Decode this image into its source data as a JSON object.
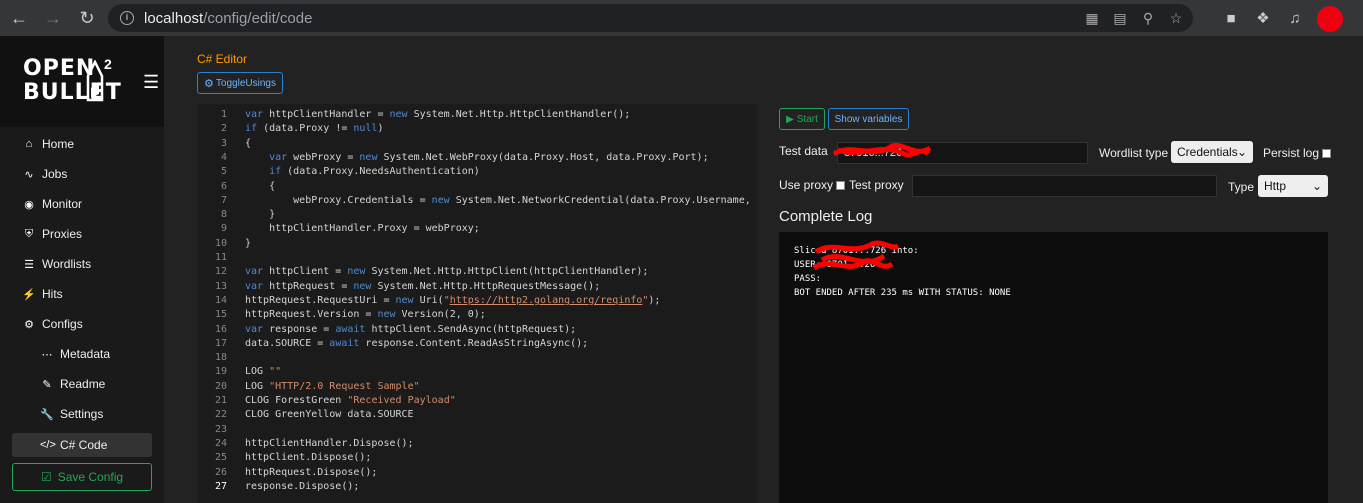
{
  "browser": {
    "url_host": "localhost",
    "url_path": "/config/edit/code"
  },
  "sidebar": {
    "logo_line1": "OPEN",
    "logo_line2": "BULLET",
    "logo_sup": "2",
    "items": [
      {
        "label": "Home",
        "icon": "home-icon"
      },
      {
        "label": "Jobs",
        "icon": "pulse-icon"
      },
      {
        "label": "Monitor",
        "icon": "eye-icon"
      },
      {
        "label": "Proxies",
        "icon": "shield-icon"
      },
      {
        "label": "Wordlists",
        "icon": "list-icon"
      },
      {
        "label": "Hits",
        "icon": "bolt-icon"
      },
      {
        "label": "Configs",
        "icon": "gear-icon"
      }
    ],
    "sub_items": [
      {
        "label": "Metadata",
        "icon": "dots-icon"
      },
      {
        "label": "Readme",
        "icon": "pencil-icon"
      },
      {
        "label": "Settings",
        "icon": "wrench-icon"
      },
      {
        "label": "C# Code",
        "icon": "code-icon"
      }
    ],
    "save_label": "Save Config"
  },
  "editor": {
    "title": "C# Editor",
    "toggle_label": "ToggleUsings",
    "lines": [
      "var httpClientHandler = new System.Net.Http.HttpClientHandler();",
      "if (data.Proxy != null)",
      "{",
      "    var webProxy = new System.Net.WebProxy(data.Proxy.Host, data.Proxy.Port);",
      "    if (data.Proxy.NeedsAuthentication)",
      "    {",
      "        webProxy.Credentials = new System.Net.NetworkCredential(data.Proxy.Username, data.Proxy.Password);",
      "    }",
      "    httpClientHandler.Proxy = webProxy;",
      "}",
      "",
      "var httpClient = new System.Net.Http.HttpClient(httpClientHandler);",
      "var httpRequest = new System.Net.Http.HttpRequestMessage();",
      "httpRequest.RequestUri = new Uri(\"https://http2.golang.org/reqinfo\");",
      "httpRequest.Version = new Version(2, 0);",
      "var response = await httpClient.SendAsync(httpRequest);",
      "data.SOURCE = await response.Content.ReadAsStringAsync();",
      "",
      "LOG \"\"",
      "LOG \"HTTP/2.0 Request Sample\"",
      "CLOG ForestGreen \"Received Payload\"",
      "CLOG GreenYellow data.SOURCE",
      "",
      "httpClientHandler.Dispose();",
      "httpClient.Dispose();",
      "httpRequest.Dispose();",
      "response.Dispose();"
    ]
  },
  "debugger": {
    "start_label": "Start",
    "vars_label": "Show variables",
    "test_data_label": "Test data",
    "test_data_value": "87016...726",
    "wordlist_type_label": "Wordlist type",
    "wordlist_type_value": "Credentials",
    "persist_log_label": "Persist log",
    "use_proxy_label": "Use proxy",
    "test_proxy_label": "Test proxy",
    "test_proxy_value": "",
    "type_label": "Type",
    "type_value": "Http",
    "log_title": "Complete Log",
    "log_lines": [
      "Sliced 8701...726 into:",
      "USER: 8701...26",
      "PASS:",
      "BOT ENDED AFTER 235 ms WITH STATUS: NONE"
    ]
  },
  "colors": {
    "accent_orange": "#ff9a00",
    "accent_green": "#1fa855",
    "accent_blue": "#2b7fd0",
    "redaction": "#ff0000"
  }
}
